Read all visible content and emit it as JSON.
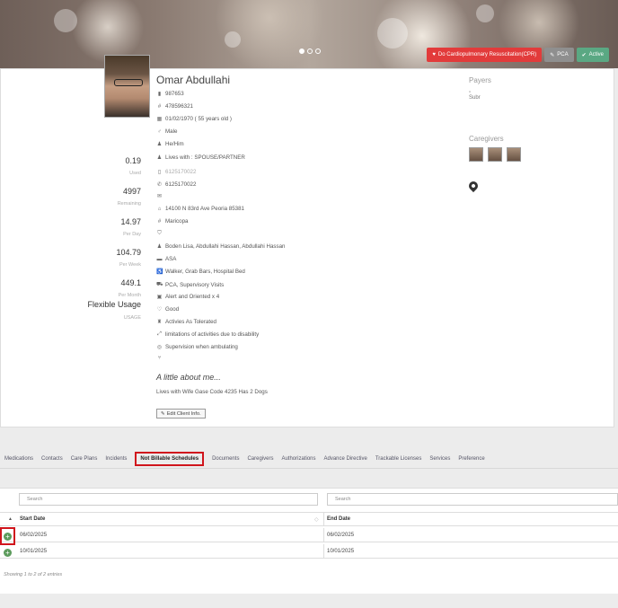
{
  "banner": {
    "badges": [
      {
        "label": "Do Cardiopulmonary Resuscitation(CPR)",
        "icon": "heart-icon",
        "color": "#e23b3b"
      },
      {
        "label": "PCA",
        "icon": "tag-icon",
        "color": "#8f8f8f"
      },
      {
        "label": "Active",
        "icon": "check-icon",
        "color": "#5aa883"
      }
    ]
  },
  "client": {
    "name": "Omar Abdullahi",
    "id": "987653",
    "number": "478596321",
    "dob": "01/02/1970 ( 55 years old )",
    "gender": "Male",
    "pronouns": "He/Him",
    "lives_with": "Lives with : SPOUSE/PARTNER",
    "phone_alt": "6125170022",
    "phone": "6125170022",
    "address": "14100 N 83rd Ave Peoria 85381",
    "county": "Maricopa",
    "contacts": "Boden Lisa, Abdullahi Hassan, Abdullahi Hassan",
    "program": "ASA",
    "equipment": "Walker, Grab Bars, Hospital Bed",
    "services": "PCA, Supervisory Visits",
    "orientation": "Alert and Oriented x 4",
    "health": "Good",
    "activities": "Activies As Tolerated",
    "limitations": "limitations of activities due to disability",
    "supervision": "Supervision when ambulating",
    "about_title": "A little about me...",
    "about_text": "Lives with Wife Gase Code 4235 Has 2 Dogs",
    "edit_label": "Edit Client Info."
  },
  "usage": {
    "used": "0.19",
    "used_label": "Used",
    "remaining": "4997",
    "remaining_label": "Remaining",
    "per_day": "14.97",
    "per_day_label": "Per Day",
    "per_week": "104.79",
    "per_week_label": "Per Week",
    "per_month": "449.1",
    "per_month_label": "Per Month",
    "type": "Flexible Usage",
    "type_label": "USAGE"
  },
  "side": {
    "payers_title": "Payers",
    "payer_img_alt": "Subr",
    "caregivers_title": "Caregivers"
  },
  "tabs": [
    "Medications",
    "Contacts",
    "Care Plans",
    "Incidents",
    "Not Billable Schedules",
    "Documents",
    "Caregivers",
    "Authorizations",
    "Advance Directive",
    "Trackable Licenses",
    "Services",
    "Preference"
  ],
  "active_tab": "Not Billable Schedules",
  "table": {
    "search_placeholder_1": "Search",
    "search_placeholder_2": "Search",
    "col_start": "Start Date",
    "col_end": "End Date",
    "rows": [
      {
        "start": "06/02/2025",
        "end": "06/02/2025"
      },
      {
        "start": "10/01/2025",
        "end": "10/01/2025"
      }
    ],
    "footer": "Showing 1 to 2 of 2 entries"
  }
}
